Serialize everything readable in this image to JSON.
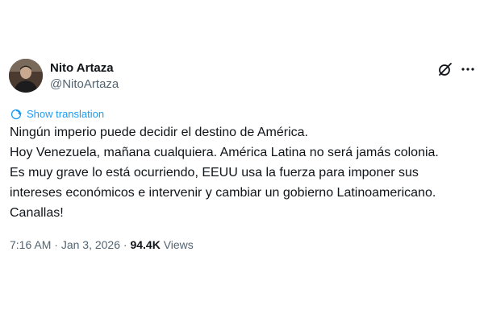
{
  "author": {
    "name": "Nito Artaza",
    "handle": "@NitoArtaza"
  },
  "actions": {
    "grok_icon": "grok-icon",
    "more_icon": "more-icon"
  },
  "translate": {
    "icon": "translate-icon",
    "label": "Show translation"
  },
  "tweet": {
    "lines": [
      "Ningún imperio puede decidir el destino de América.",
      "Hoy Venezuela, mañana cualquiera. América Latina no será jamás colonia.",
      "Es muy grave lo está ocurriendo, EEUU usa la fuerza para imponer sus",
      "intereses económicos e intervenir y cambiar un gobierno Latinoamericano.",
      "Canallas!"
    ]
  },
  "meta": {
    "time": "7:16 AM",
    "separator": " · ",
    "date": "Jan 3, 2026",
    "views_count": "94.4K",
    "views_label": "Views"
  },
  "colors": {
    "text": "#0f1419",
    "secondary": "#536471",
    "accent": "#1d9bf0"
  }
}
